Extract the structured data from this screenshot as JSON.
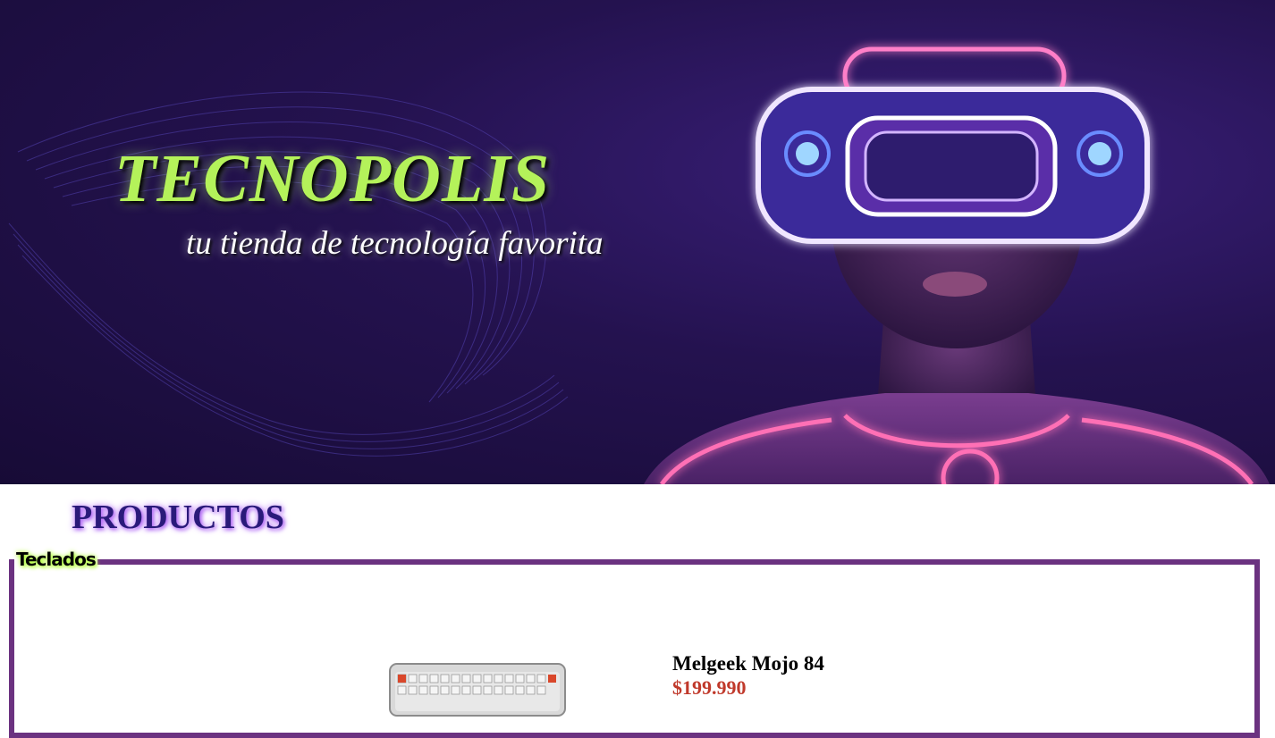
{
  "hero": {
    "title": "TECNOPOLIS",
    "subtitle": "tu tienda de tecnología favorita",
    "image_icon": "vr-headset-person-illustration"
  },
  "products_section": {
    "title": "PRODUCTOS",
    "categories": [
      {
        "name": "Teclados",
        "products": [
          {
            "name": "Melgeek Mojo 84",
            "price": "$199.990",
            "image_icon": "keyboard-image"
          }
        ]
      }
    ]
  },
  "colors": {
    "title_green": "#b4f25a",
    "section_purple": "#2a1a7a",
    "border_purple": "#6b3280",
    "price_red": "#c0392b"
  }
}
